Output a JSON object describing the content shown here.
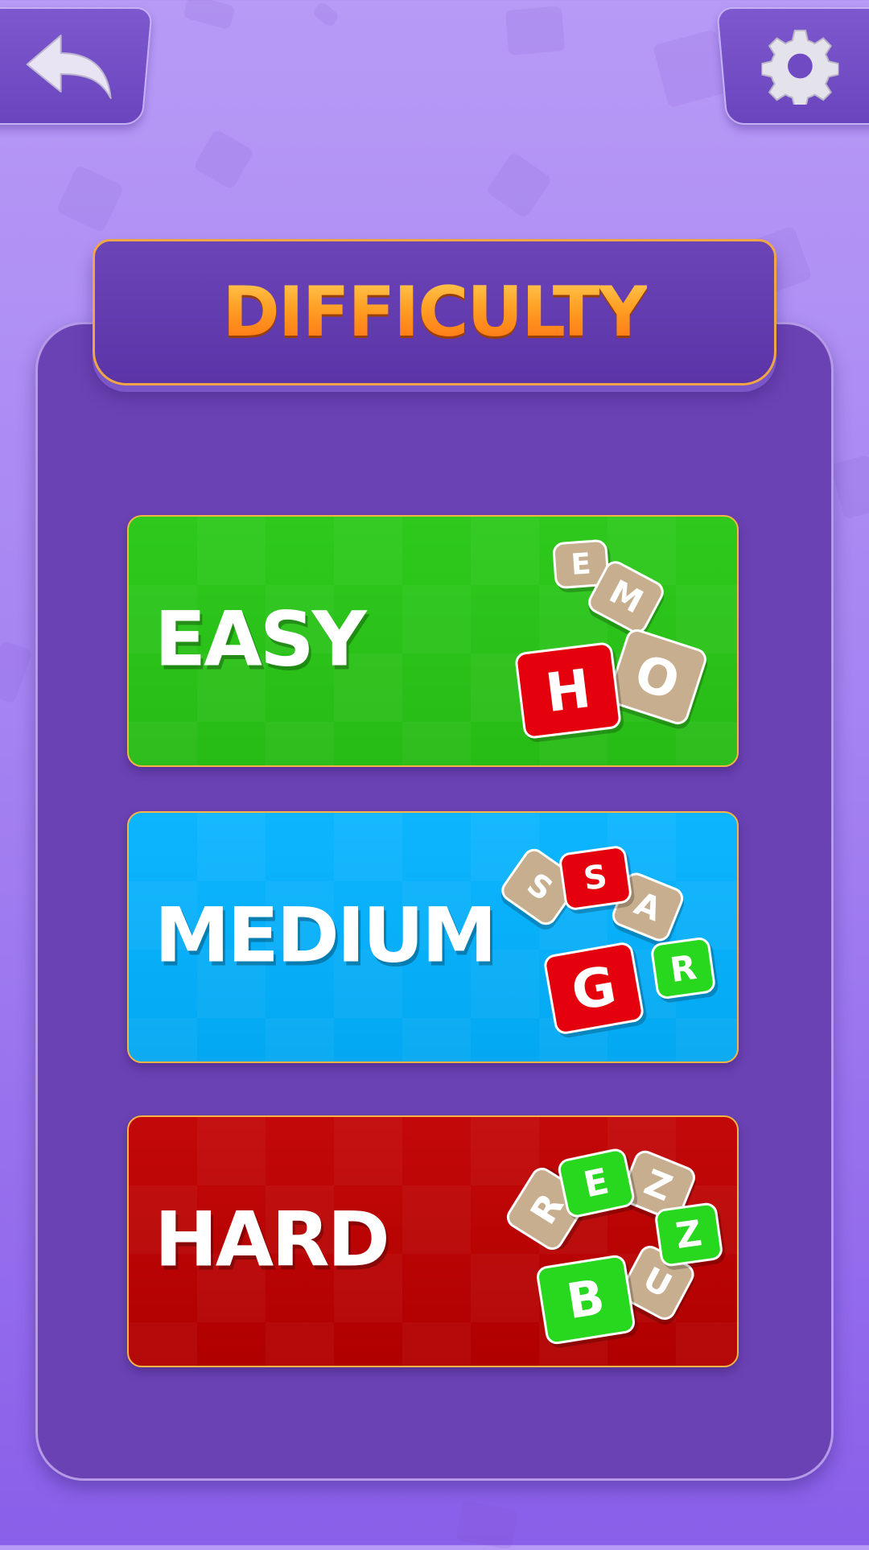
{
  "header": {
    "back_icon": "back-arrow-icon",
    "settings_icon": "gear-icon"
  },
  "title": "DIFFICULTY",
  "colors": {
    "background": "#a684f2",
    "panel": "#6b42b3",
    "title_orange": "#ff9a1a",
    "easy": "#27bb16",
    "medium": "#03a8f2",
    "hard": "#b00000",
    "tile_tan": "#c7ae8e",
    "tile_red": "#e4000c",
    "tile_green": "#28d81e"
  },
  "levels": [
    {
      "label": "EASY",
      "tiles": [
        {
          "letter": "E",
          "color": "tan"
        },
        {
          "letter": "M",
          "color": "tan"
        },
        {
          "letter": "H",
          "color": "red"
        },
        {
          "letter": "O",
          "color": "tan"
        }
      ]
    },
    {
      "label": "MEDIUM",
      "tiles": [
        {
          "letter": "S",
          "color": "tan"
        },
        {
          "letter": "S",
          "color": "red"
        },
        {
          "letter": "A",
          "color": "tan"
        },
        {
          "letter": "G",
          "color": "red"
        },
        {
          "letter": "R",
          "color": "green"
        }
      ]
    },
    {
      "label": "HARD",
      "tiles": [
        {
          "letter": "R",
          "color": "tan"
        },
        {
          "letter": "E",
          "color": "green"
        },
        {
          "letter": "Z",
          "color": "tan"
        },
        {
          "letter": "Z",
          "color": "green"
        },
        {
          "letter": "U",
          "color": "tan"
        },
        {
          "letter": "B",
          "color": "green"
        }
      ]
    }
  ]
}
